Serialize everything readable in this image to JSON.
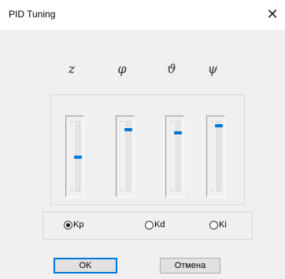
{
  "window": {
    "title": "PID Tuning",
    "close_glyph": "✕"
  },
  "axes": [
    {
      "symbol": "z",
      "level": 0.48
    },
    {
      "symbol": "φ",
      "level": 0.87
    },
    {
      "symbol": "ϑ",
      "level": 0.83
    },
    {
      "symbol": "ψ",
      "level": 0.93
    }
  ],
  "gain_options": [
    {
      "label": "Kp",
      "checked": true
    },
    {
      "label": "Kd",
      "checked": false
    },
    {
      "label": "Ki",
      "checked": false
    }
  ],
  "buttons": {
    "ok_label": "OK",
    "cancel_label": "Отмена"
  },
  "colors": {
    "thumb": "#0078d7",
    "default_button_border": "#0078d7"
  }
}
